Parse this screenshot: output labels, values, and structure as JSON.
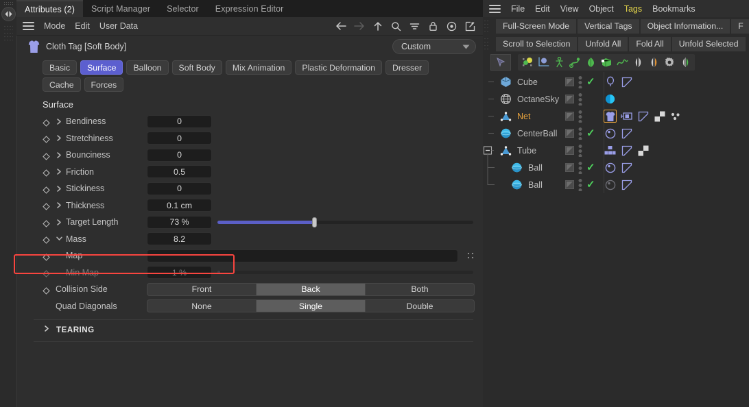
{
  "attributes_panel": {
    "tabs": [
      {
        "label": "Attributes (2)",
        "active": true
      },
      {
        "label": "Script Manager",
        "active": false
      },
      {
        "label": "Selector",
        "active": false
      },
      {
        "label": "Expression Editor",
        "active": false
      }
    ],
    "menu": [
      "Mode",
      "Edit",
      "User Data"
    ],
    "toolbar_icons": [
      "back-arrow-icon",
      "forward-arrow-icon",
      "up-arrow-icon",
      "search-icon",
      "filter-icon",
      "lock-icon",
      "record-icon",
      "open-external-icon"
    ],
    "object_title": "Cloth Tag [Soft Body]",
    "object_icon": "cloth-tag-icon",
    "preset": {
      "value": "Custom"
    },
    "chips_row1": [
      {
        "label": "Basic",
        "active": false
      },
      {
        "label": "Surface",
        "active": true
      },
      {
        "label": "Balloon",
        "active": false
      },
      {
        "label": "Soft Body",
        "active": false
      },
      {
        "label": "Mix Animation",
        "active": false
      },
      {
        "label": "Plastic Deformation",
        "active": false
      },
      {
        "label": "Dresser",
        "active": false
      }
    ],
    "chips_row2": [
      {
        "label": "Cache",
        "active": false
      },
      {
        "label": "Forces",
        "active": false
      }
    ],
    "section_title": "Surface",
    "parameters": [
      {
        "label": "Bendiness",
        "value": "0",
        "kind": "field",
        "arrow": "right",
        "dim": false
      },
      {
        "label": "Stretchiness",
        "value": "0",
        "kind": "field",
        "arrow": "right",
        "dim": false
      },
      {
        "label": "Bounciness",
        "value": "0",
        "kind": "field",
        "arrow": "right",
        "dim": false
      },
      {
        "label": "Friction",
        "value": "0.5",
        "kind": "field",
        "arrow": "right",
        "dim": false
      },
      {
        "label": "Stickiness",
        "value": "0",
        "kind": "field",
        "arrow": "right",
        "dim": false
      },
      {
        "label": "Thickness",
        "value": "0.1 cm",
        "kind": "field",
        "arrow": "right",
        "dim": false
      },
      {
        "label": "Target Length",
        "value": "73 %",
        "kind": "slider",
        "arrow": "right",
        "dim": false,
        "percent": 38
      },
      {
        "label": "Mass",
        "value": "8.2",
        "kind": "field",
        "arrow": "down",
        "dim": false,
        "highlighted": true
      },
      {
        "label": "Map",
        "value": "",
        "kind": "link",
        "arrow": "none",
        "dim": false
      },
      {
        "label": "Min Map",
        "value": "1 %",
        "kind": "slider",
        "arrow": "none",
        "dim": true,
        "percent": 1
      }
    ],
    "collision_side": {
      "label": "Collision Side",
      "options": [
        "Front",
        "Back",
        "Both"
      ],
      "selected": "Back"
    },
    "quad_diagonals": {
      "label": "Quad Diagonals",
      "options": [
        "None",
        "Single",
        "Double"
      ],
      "selected": "Single"
    },
    "tearing_group": {
      "label": "TEARING",
      "expanded": false
    },
    "highlight_color": "#f9453f",
    "accent_color": "#5c5fcf"
  },
  "object_manager": {
    "menu": [
      {
        "label": "File",
        "highlight": false
      },
      {
        "label": "Edit",
        "highlight": false
      },
      {
        "label": "View",
        "highlight": false
      },
      {
        "label": "Object",
        "highlight": false
      },
      {
        "label": "Tags",
        "highlight": true
      },
      {
        "label": "Bookmarks",
        "highlight": false
      }
    ],
    "strip_row1": [
      "Full-Screen Mode",
      "Vertical Tags",
      "Object Information...",
      "F"
    ],
    "strip_row2": [
      "Scroll to Selection",
      "Unfold All",
      "Fold All",
      "Unfold Selected"
    ],
    "iconbar": [
      "select-objects-icon",
      "axis-icon",
      "figure-icon",
      "spline-icon",
      "deformer-icon",
      "generator-icon",
      "curve-icon",
      "mirror-icon",
      "mirror-orange-icon",
      "gear-icon",
      "mirror-green-icon"
    ],
    "tree": [
      {
        "name": "Cube",
        "icon": "cube-icon",
        "selected": false,
        "indent": 0,
        "expander": "none",
        "check": true,
        "tags": [
          {
            "icon": "light-tag-icon",
            "selected": false
          },
          {
            "icon": "phong-tag-icon",
            "selected": false
          }
        ]
      },
      {
        "name": "OctaneSky",
        "icon": "sky-icon",
        "selected": false,
        "indent": 0,
        "expander": "none",
        "check": false,
        "tags": [
          {
            "icon": "octane-tag-icon",
            "selected": false
          }
        ]
      },
      {
        "name": "Net",
        "icon": "polygon-icon",
        "selected": true,
        "indent": 0,
        "expander": "none",
        "check": false,
        "tags": [
          {
            "icon": "cloth-tag-icon",
            "selected": true
          },
          {
            "icon": "cloth-belt-tag-icon",
            "selected": false
          },
          {
            "icon": "phong-tag-icon",
            "selected": false
          },
          {
            "icon": "texture-tag-icon",
            "selected": false
          },
          {
            "icon": "vertex-map-tag-icon",
            "selected": false
          }
        ]
      },
      {
        "name": "CenterBall",
        "icon": "sphere-icon",
        "selected": false,
        "indent": 0,
        "expander": "none",
        "check": true,
        "tags": [
          {
            "icon": "dynamics-tag-icon",
            "selected": false
          },
          {
            "icon": "phong-tag-icon",
            "selected": false
          }
        ]
      },
      {
        "name": "Tube",
        "icon": "polygon-icon",
        "selected": false,
        "indent": 0,
        "expander": "minus",
        "check": false,
        "tags": [
          {
            "icon": "connector-tag-icon",
            "selected": false
          },
          {
            "icon": "phong-tag-icon",
            "selected": false
          },
          {
            "icon": "texture-tag-icon",
            "selected": false
          }
        ]
      },
      {
        "name": "Ball",
        "icon": "sphere-icon",
        "selected": false,
        "indent": 1,
        "expander": "none",
        "check": true,
        "tags": [
          {
            "icon": "dynamics-tag-icon",
            "selected": false
          },
          {
            "icon": "phong-tag-icon",
            "selected": false
          }
        ]
      },
      {
        "name": "Ball",
        "icon": "sphere-icon",
        "selected": false,
        "indent": 1,
        "expander": "none",
        "check": true,
        "tags": [
          {
            "icon": "dynamics-dim-tag-icon",
            "selected": false
          },
          {
            "icon": "phong-tag-icon",
            "selected": false
          }
        ]
      }
    ]
  }
}
